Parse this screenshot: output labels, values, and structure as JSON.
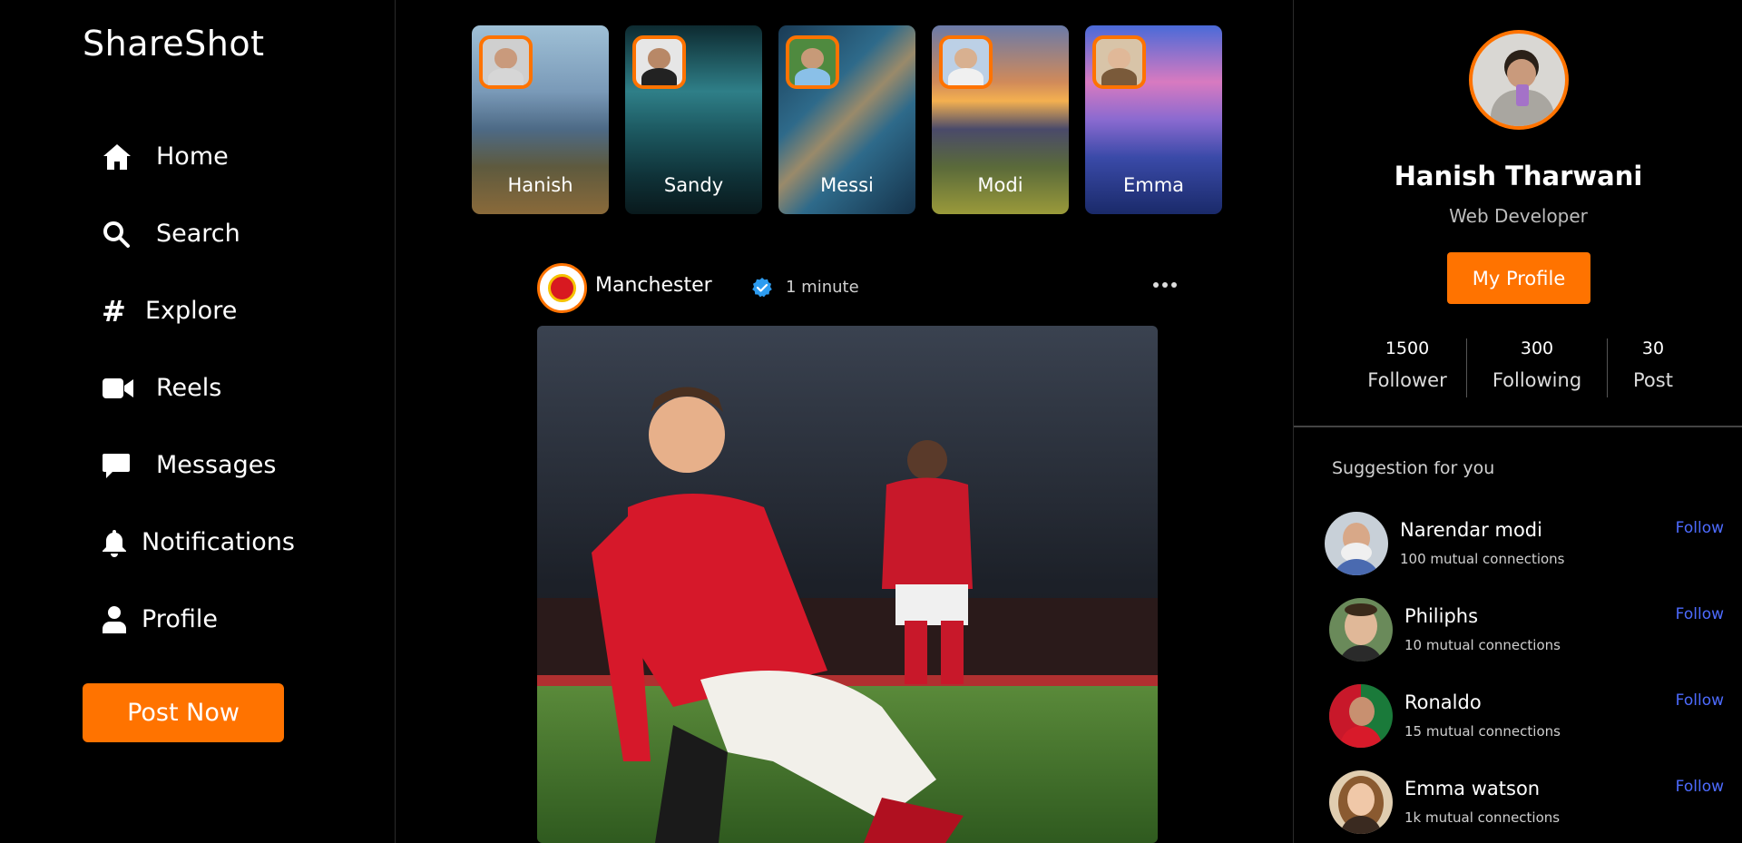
{
  "app": {
    "logo": "ShareShot"
  },
  "sidebar": {
    "items": [
      {
        "label": "Home",
        "icon": "home-icon"
      },
      {
        "label": "Search",
        "icon": "search-icon"
      },
      {
        "label": "Explore",
        "icon": "hashtag-icon"
      },
      {
        "label": "Reels",
        "icon": "video-camera-icon"
      },
      {
        "label": "Messages",
        "icon": "message-icon"
      },
      {
        "label": "Notifications",
        "icon": "bell-icon"
      },
      {
        "label": "Profile",
        "icon": "user-icon"
      }
    ],
    "post_button": "Post Now"
  },
  "stories": [
    {
      "name": "Hanish"
    },
    {
      "name": "Sandy"
    },
    {
      "name": "Messi"
    },
    {
      "name": "Modi"
    },
    {
      "name": "Emma"
    }
  ],
  "post": {
    "user": "Manchester",
    "time": "1 minute",
    "verified": true
  },
  "profile": {
    "name": "Hanish Tharwani",
    "role": "Web Developer",
    "button": "My Profile",
    "stats": [
      {
        "value": "1500",
        "label": "Follower"
      },
      {
        "value": "300",
        "label": "Following"
      },
      {
        "value": "30",
        "label": "Post"
      }
    ]
  },
  "suggestions": {
    "title": "Suggestion for you",
    "follow_label": "Follow",
    "items": [
      {
        "name": "Narendar modi",
        "mutual": "100 mutual connections"
      },
      {
        "name": "Philiphs",
        "mutual": "10 mutual connections"
      },
      {
        "name": "Ronaldo",
        "mutual": "15 mutual connections"
      },
      {
        "name": "Emma watson",
        "mutual": "1k mutual connections"
      }
    ]
  },
  "colors": {
    "accent": "#ff7300",
    "follow": "#4d6bff",
    "background": "#000000"
  }
}
